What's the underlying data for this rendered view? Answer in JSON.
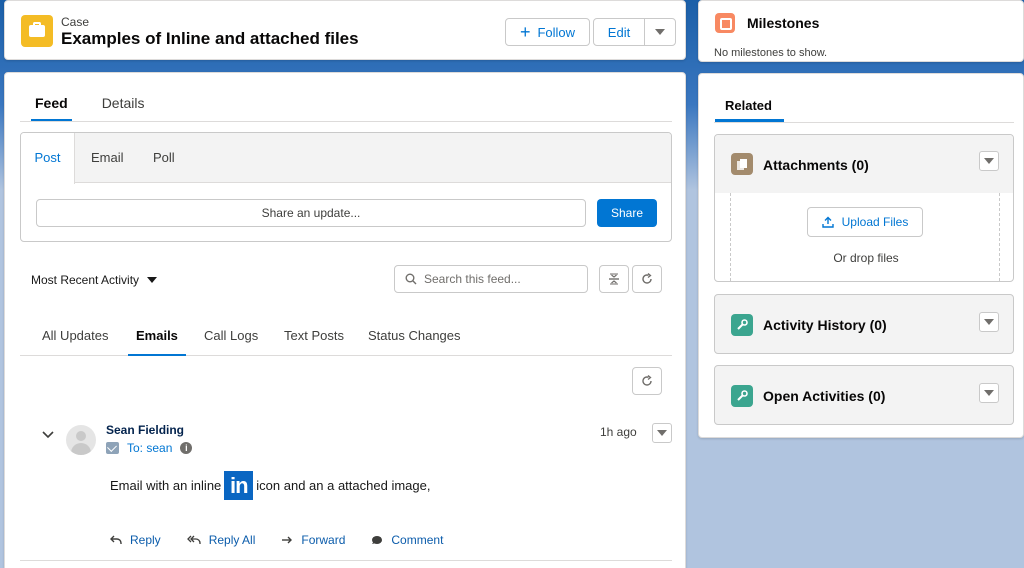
{
  "header": {
    "object_type": "Case",
    "title": "Examples of Inline and attached files",
    "follow_label": "Follow",
    "edit_label": "Edit"
  },
  "main_tabs": {
    "feed": "Feed",
    "details": "Details"
  },
  "publisher": {
    "tabs": {
      "post": "Post",
      "email": "Email",
      "poll": "Poll"
    },
    "placeholder": "Share an update...",
    "share_label": "Share"
  },
  "feed_controls": {
    "sort_label": "Most Recent Activity",
    "search_placeholder": "Search this feed..."
  },
  "filter_tabs": {
    "all": "All Updates",
    "emails": "Emails",
    "calls": "Call Logs",
    "text": "Text Posts",
    "status": "Status Changes"
  },
  "feed_item": {
    "author": "Sean Fielding",
    "to": "To: sean",
    "time": "1h ago",
    "body_before": "Email with an inline",
    "inline_image_text": "in",
    "body_after": "icon and an a attached image,",
    "actions": {
      "reply": "Reply",
      "reply_all": "Reply All",
      "forward": "Forward",
      "comment": "Comment"
    }
  },
  "milestones": {
    "title": "Milestones",
    "empty": "No milestones to show."
  },
  "related": {
    "tab": "Related",
    "attachments": {
      "title": "Attachments (0)",
      "upload": "Upload Files",
      "drop": "Or drop files"
    },
    "activity_history": {
      "title": "Activity History (0)"
    },
    "open_activities": {
      "title": "Open Activities (0)"
    }
  },
  "colors": {
    "brand_blue": "#0176d3",
    "case_icon": "#f4bc25",
    "milestone_icon": "#f88962",
    "attachments_icon": "#a38b6d",
    "activity_icon": "#3ba58f",
    "linkedin": "#0a66c2"
  },
  "icons": [
    "case-icon",
    "plus-icon",
    "chevron-down-icon",
    "search-icon",
    "collapse-icon",
    "refresh-icon",
    "avatar",
    "email-icon",
    "info-icon",
    "reply-icon",
    "reply-all-icon",
    "forward-icon",
    "comment-icon",
    "milestone-icon",
    "attachments-icon",
    "upload-icon",
    "wrench-icon"
  ]
}
